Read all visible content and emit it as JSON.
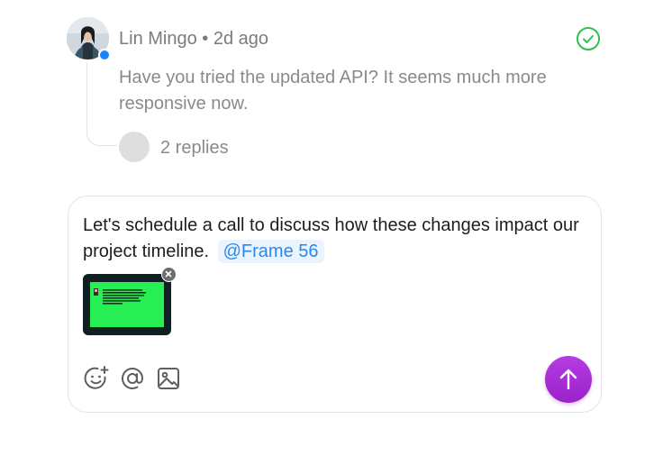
{
  "comment": {
    "author": "Lin Mingo",
    "separator": "•",
    "time": "2d ago",
    "text": "Have you tried the updated API? It seems much more responsive now.",
    "replies_label": "2 replies",
    "resolve_icon": "check-circle-icon",
    "status_color": "#1a84ff",
    "resolve_color": "#2cc24c"
  },
  "composer": {
    "text": "Let's schedule a call to discuss how these changes impact our project timeline.",
    "mention": "@Frame 56",
    "attachment": {
      "icon": "image-thumbnail",
      "thumb_text": "WE BELIEVE THAT CODE IS A POWERFUL TOOL THAT CAN BE USED TO COMMUNICATE, CREATE AND ENGAGE IN A WAY THAT IS ENTERTAINING, INSIGHTFUL AND BRANDING.",
      "color": "#27ef53"
    },
    "tools": [
      "emoji-add-icon",
      "at-mention-icon",
      "image-icon"
    ],
    "send_icon": "arrow-up-icon",
    "send_color": "#a52ed4"
  }
}
